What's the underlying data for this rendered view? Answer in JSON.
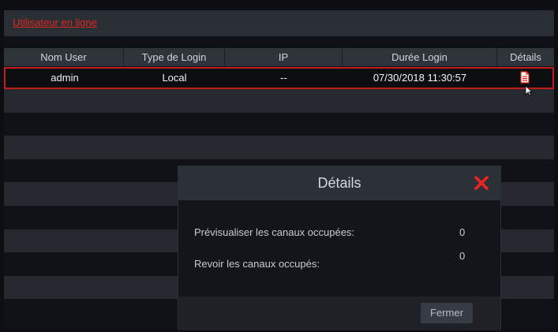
{
  "window": {
    "title": "Utilisateur en ligne"
  },
  "table": {
    "columns": [
      "Nom User",
      "Type de Login",
      "IP",
      "Durée Login",
      "Détails"
    ],
    "rows": [
      {
        "user": "admin",
        "login_type": "Local",
        "ip": "--",
        "duration": "07/30/2018 11:30:57"
      }
    ]
  },
  "dialog": {
    "title": "Détails",
    "fields": [
      {
        "label": "Prévisualiser les canaux occupées:",
        "value": "0"
      },
      {
        "label": "Revoir les canaux occupés:",
        "value": "0"
      }
    ],
    "close_button": "Fermer"
  },
  "colors": {
    "accent": "#e0261c",
    "selected_border": "#c41c1c"
  },
  "icons": {
    "details": "document-icon",
    "close": "close-x-icon",
    "cursor": "mouse-pointer-icon"
  }
}
